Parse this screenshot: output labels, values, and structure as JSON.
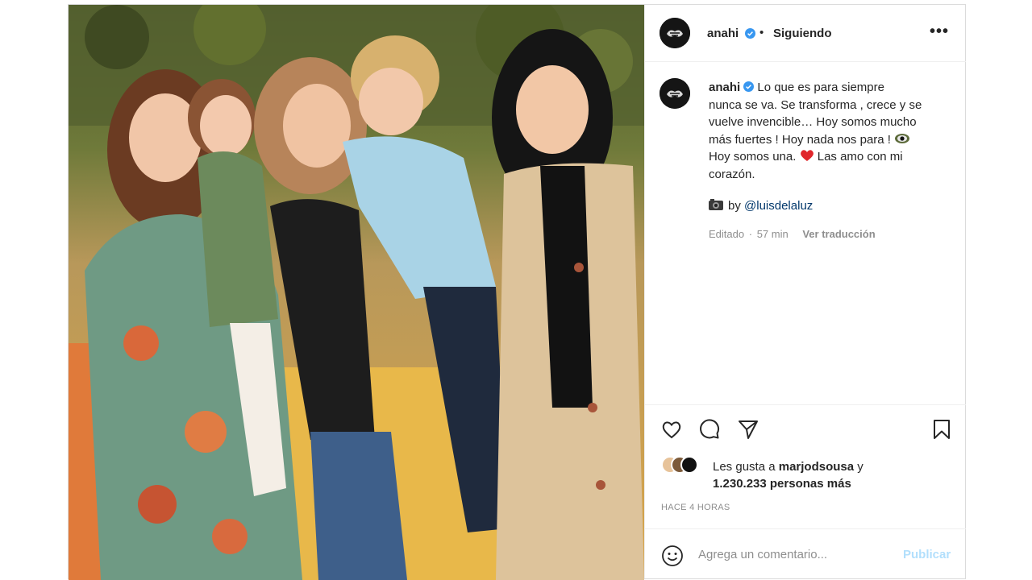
{
  "post": {
    "username": "anahi",
    "separator": "•",
    "follow_status": "Siguiendo",
    "more_label": "•••",
    "caption_lines": [
      "Lo que es para siempre",
      "nunca se va. Se transforma , crece y se",
      "vuelve invencible… Hoy somos mucho",
      "más fuertes ! Hoy nada nos para !",
      "Hoy somos una.",
      "Las amo con mi",
      "corazón."
    ],
    "photo_credit_prefix": "by",
    "photo_credit_mention": "@luisdelaluz",
    "edited_label": "Editado",
    "meta_separator": "·",
    "time_ago": "57 min",
    "translate_label": "Ver traducción",
    "likes_prefix": "Les gusta a",
    "likes_user": "marjodsousa",
    "likes_connector": "y",
    "likes_count": "1.230.233 personas más",
    "posted_time": "HACE 4 HORAS",
    "comment_placeholder": "Agrega un comentario...",
    "publish_label": "Publicar"
  },
  "icons": {
    "verified": "verified-badge-icon",
    "like": "heart-outline-icon",
    "comment": "comment-bubble-icon",
    "share": "paper-plane-icon",
    "save": "bookmark-icon",
    "emoji": "smiley-icon",
    "camera": "camera-emoji-icon",
    "red_heart": "red-heart-emoji-icon",
    "eye": "eye-emoji-icon"
  },
  "colors": {
    "verified_blue": "#3897f0",
    "mention": "#00376b",
    "muted": "#8e8e8e",
    "publish_disabled": "#b2dffc",
    "heart_red": "#ed4956"
  }
}
